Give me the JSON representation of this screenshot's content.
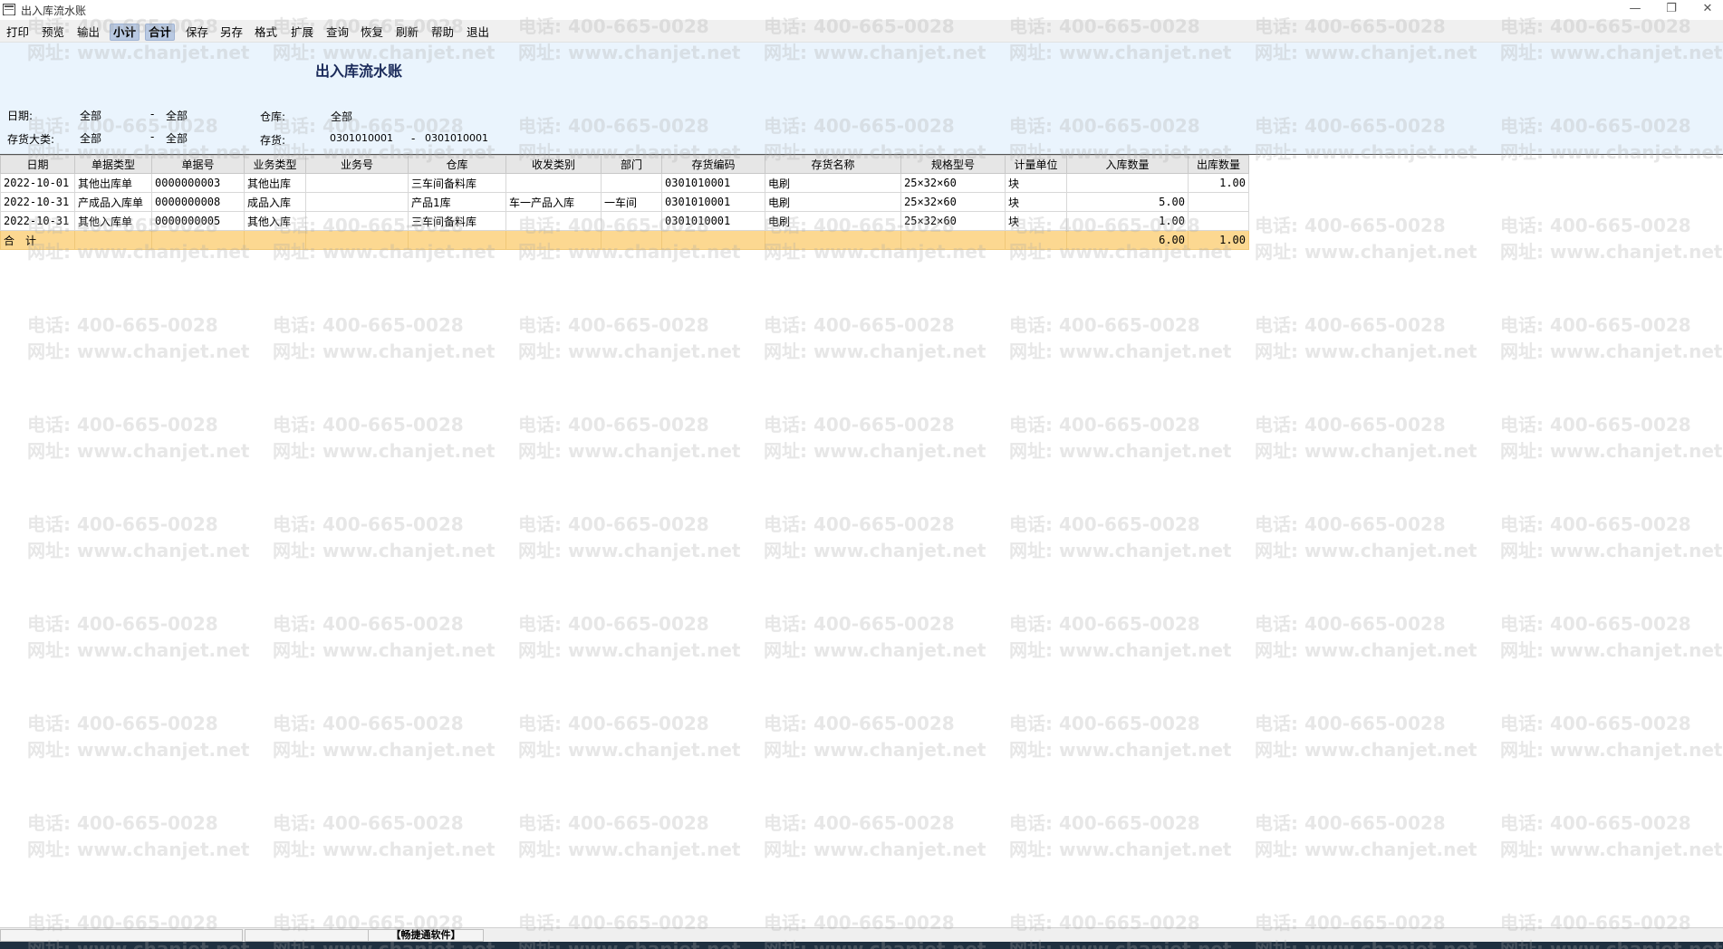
{
  "window": {
    "title": "出入库流水账",
    "minimize_icon": "minimize-icon",
    "maximize_icon": "restore-icon",
    "close_icon": "close-icon"
  },
  "toolbar": {
    "items": [
      {
        "label": "打印",
        "active": false
      },
      {
        "label": "预览",
        "active": false
      },
      {
        "label": "输出",
        "active": false
      },
      {
        "label": "小计",
        "active": true
      },
      {
        "label": "合计",
        "active": true
      },
      {
        "label": "保存",
        "active": false
      },
      {
        "label": "另存",
        "active": false
      },
      {
        "label": "格式",
        "active": false
      },
      {
        "label": "扩展",
        "active": false
      },
      {
        "label": "查询",
        "active": false
      },
      {
        "label": "恢复",
        "active": false
      },
      {
        "label": "刷新",
        "active": false
      },
      {
        "label": "帮助",
        "active": false
      },
      {
        "label": "退出",
        "active": false
      }
    ]
  },
  "header": {
    "title": "出入库流水账",
    "date_label": "日期:",
    "date_from": "全部",
    "date_sep": "-",
    "date_to": "全部",
    "warehouse_label": "仓库:",
    "warehouse_value": "全部",
    "category_label": "存货大类:",
    "category_from": "全部",
    "category_sep": "-",
    "category_to": "全部",
    "inventory_label": "存货:",
    "inventory_from": "0301010001",
    "inventory_sep": "-",
    "inventory_to": "0301010001"
  },
  "table": {
    "columns": [
      "日期",
      "单据类型",
      "单据号",
      "业务类型",
      "业务号",
      "仓库",
      "收发类别",
      "部门",
      "存货编码",
      "存货名称",
      "规格型号",
      "计量单位",
      "入库数量",
      "出库数量"
    ],
    "rows": [
      [
        "2022-10-01",
        "其他出库单",
        "0000000003",
        "其他出库",
        "",
        "三车间备料库",
        "",
        "",
        "0301010001",
        "电刷",
        "25×32×60",
        "块",
        "",
        "1.00"
      ],
      [
        "2022-10-31",
        "产成品入库单",
        "0000000008",
        "成品入库",
        "",
        "产品1库",
        "车一产品入库",
        "一车间",
        "0301010001",
        "电刷",
        "25×32×60",
        "块",
        "5.00",
        ""
      ],
      [
        "2022-10-31",
        "其他入库单",
        "0000000005",
        "其他入库",
        "",
        "三车间备料库",
        "",
        "",
        "0301010001",
        "电刷",
        "25×32×60",
        "块",
        "1.00",
        ""
      ]
    ],
    "total": {
      "label": "合　计",
      "in_qty": "6.00",
      "out_qty": "1.00"
    }
  },
  "watermark": {
    "phone": "电话: 400-665-0028",
    "site": "网址: www.chanjet.net"
  },
  "statusbar": {
    "brand": "【畅捷通软件】"
  },
  "colors": {
    "header_bg": "#eaf4fd",
    "total_row_bg": "#fcd891",
    "toolbar_active": "#b9c9e2"
  }
}
